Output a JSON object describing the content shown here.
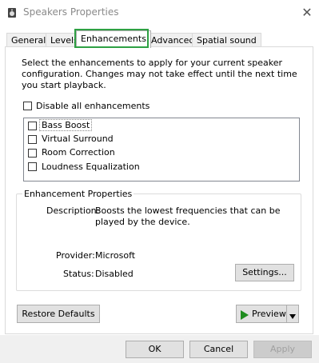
{
  "window": {
    "title": "Speakers Properties",
    "close_symbol": "✕"
  },
  "tabs": [
    {
      "label": "General"
    },
    {
      "label": "Levels"
    },
    {
      "label": "Enhancements"
    },
    {
      "label": "Advanced"
    },
    {
      "label": "Spatial sound"
    }
  ],
  "enhancements": {
    "instructions": "Select the enhancements to apply for your current speaker configuration. Changes may not take effect until the next time you start playback.",
    "disable_all_label": "Disable all enhancements",
    "items": [
      {
        "label": "Bass Boost"
      },
      {
        "label": "Virtual Surround"
      },
      {
        "label": "Room Correction"
      },
      {
        "label": "Loudness Equalization"
      }
    ]
  },
  "properties": {
    "group_title": "Enhancement Properties",
    "description_label": "Description:",
    "description_value": "Boosts the lowest frequencies that can be played by the device.",
    "provider_label": "Provider:",
    "provider_value": "Microsoft",
    "status_label": "Status:",
    "status_value": "Disabled",
    "settings_button": "Settings..."
  },
  "actions": {
    "restore_defaults": "Restore Defaults",
    "preview": "Preview",
    "ok": "OK",
    "cancel": "Cancel",
    "apply": "Apply"
  },
  "colors": {
    "tab_highlight": "#2ea043",
    "preview_icon": "#1e8c1e"
  }
}
